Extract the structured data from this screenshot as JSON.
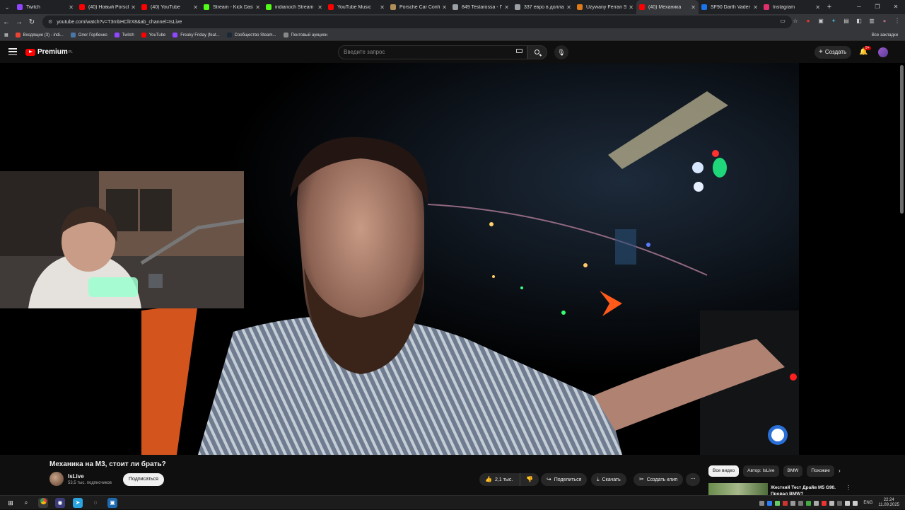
{
  "browser": {
    "tabs": [
      {
        "label": "Twitch",
        "color": "#9146ff"
      },
      {
        "label": "(40) Новый Porsche",
        "color": "#ff0000"
      },
      {
        "label": "(40) YouTube",
        "color": "#ff0000"
      },
      {
        "label": "Stream - Kick Dash",
        "color": "#53fc18"
      },
      {
        "label": "indianoch Stream -",
        "color": "#53fc18"
      },
      {
        "label": "YouTube Music",
        "color": "#ff0000"
      },
      {
        "label": "Porsche Car Config",
        "color": "#b08d57"
      },
      {
        "label": "849 Testarossa - П",
        "color": "#9aa0a6"
      },
      {
        "label": "337 евро в доллар",
        "color": "#9aa0a6"
      },
      {
        "label": "Używany Ferrari SF",
        "color": "#e07b1a"
      },
      {
        "label": "(40) Механика",
        "color": "#ff0000",
        "active": true
      },
      {
        "label": "SF90 Darth Vader -",
        "color": "#1a73e8"
      },
      {
        "label": "Instagram",
        "color": "#e1306c"
      }
    ],
    "url": "youtube.com/watch?v=T3mbHCllrX8&ab_channel=IsLive",
    "bookmarks": [
      {
        "label": "Входящие (3) - indi...",
        "color": "#ea4335"
      },
      {
        "label": "Олег Горбенко",
        "color": "#4a76a8"
      },
      {
        "label": "Twitch",
        "color": "#9146ff"
      },
      {
        "label": "YouTube",
        "color": "#ff0000"
      },
      {
        "label": "Freaky Friday (feat...",
        "color": "#9146ff"
      },
      {
        "label": "Сообщество Steam...",
        "color": "#1b2838"
      },
      {
        "label": "Понтовый аукцион",
        "color": "#888888"
      }
    ],
    "bookmarks_right": "Все закладки"
  },
  "youtube": {
    "logo_word": "Premium",
    "logo_sup": "PL",
    "search_placeholder": "Введите запрос",
    "create_label": "Создать",
    "notif_badge": "9+"
  },
  "video": {
    "title": "Механика на M3, стоит ли брать?",
    "channel": "IsLive",
    "subscribers": "53,5 тыс. подписчиков",
    "subscribe_label": "Подписаться",
    "likes": "2,1 тыс.",
    "share_label": "Поделиться",
    "download_label": "Скачать",
    "clip_label": "Создать клип"
  },
  "sidebar": {
    "chips": [
      "Все видео",
      "Автор: IsLive",
      "BMW",
      "Похожие"
    ],
    "rec_title": "Жесткий Тест Драйв M5 G90. Провал BMW?"
  },
  "taskbar": {
    "lang": "ENG",
    "time": "22:24",
    "date": "11.09.2025"
  }
}
